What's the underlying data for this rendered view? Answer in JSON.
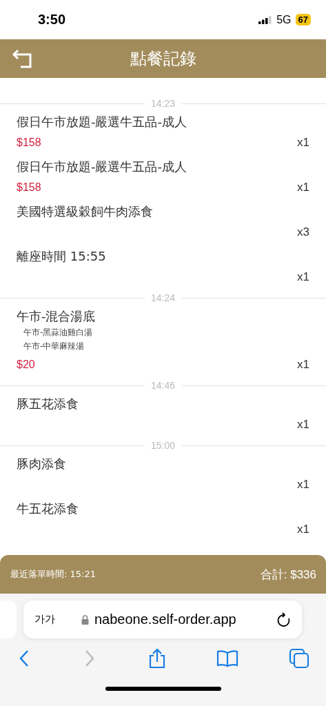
{
  "status_bar": {
    "time": "3:50",
    "network": "5G",
    "battery": "67"
  },
  "header": {
    "title": "點餐記錄"
  },
  "groups": [
    {
      "time": "14:23",
      "items": [
        {
          "name": "假日午市放題-嚴選牛五品-成人",
          "price": "$158",
          "qty": "x1"
        },
        {
          "name": "假日午市放題-嚴選牛五品-成人",
          "price": "$158",
          "qty": "x1"
        },
        {
          "name": "美國特選級穀飼牛肉添食",
          "qty": "x3"
        },
        {
          "name": "離座時間 15:55",
          "qty": "x1"
        }
      ]
    },
    {
      "time": "14:24",
      "items": [
        {
          "name": "午市-混合湯底",
          "options": [
            "午市-黑蒜油雞白湯",
            "午市-中華麻辣湯"
          ],
          "price": "$20",
          "qty": "x1"
        }
      ]
    },
    {
      "time": "14:46",
      "items": [
        {
          "name": "豚五花添食",
          "qty": "x1"
        }
      ]
    },
    {
      "time": "15:00",
      "items": [
        {
          "name": "豚肉添食",
          "qty": "x1"
        },
        {
          "name": "牛五花添食",
          "qty": "x1"
        }
      ]
    }
  ],
  "footer": {
    "last_order": "最近落單時間: 15:21",
    "total": "合計: $336"
  },
  "browser": {
    "text_size": "가가",
    "url": "nabeone.self-order.app",
    "forward_disabled": true
  }
}
